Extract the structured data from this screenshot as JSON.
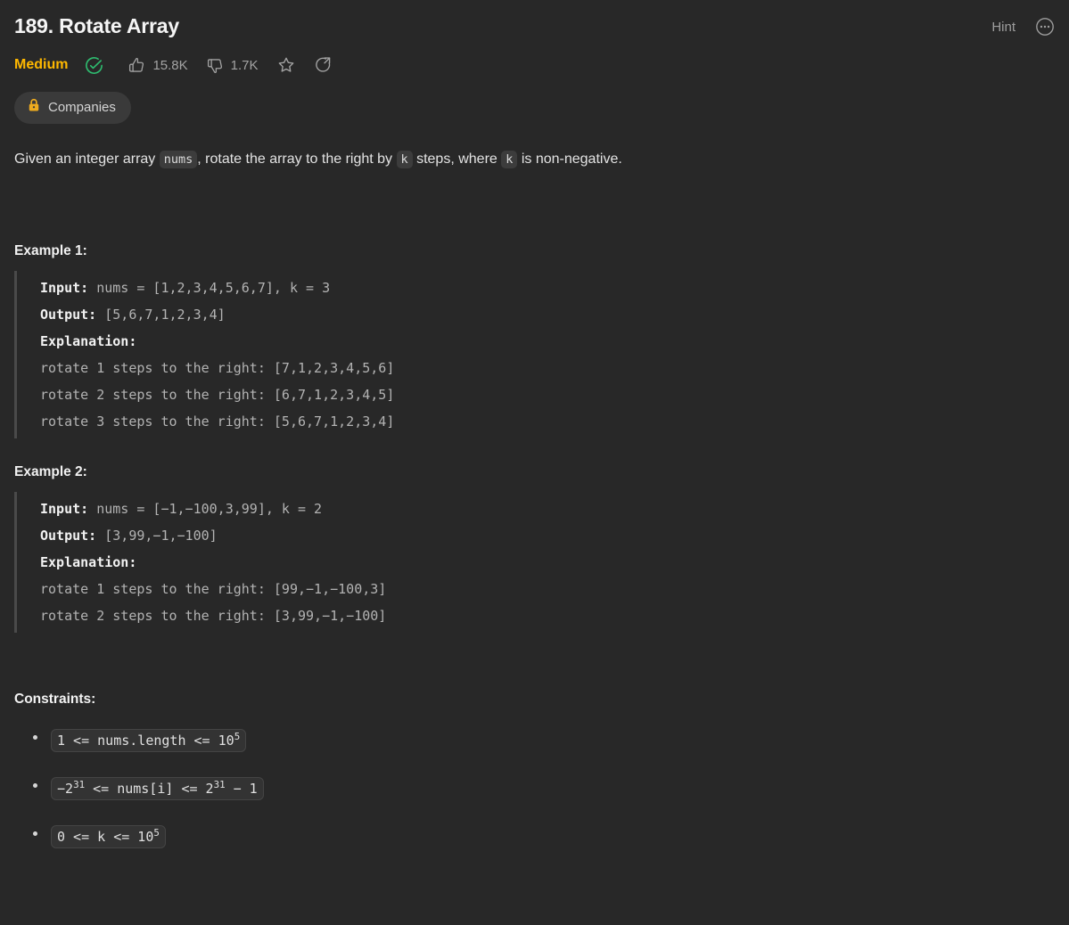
{
  "header": {
    "title": "189. Rotate Array",
    "hint_label": "Hint",
    "more_icon": "ellipsis-circle-icon"
  },
  "meta": {
    "difficulty": "Medium",
    "difficulty_color": "#ffb800",
    "solved_icon": "check-circle-icon",
    "solved_color": "#2ebd70",
    "likes": "15.8K",
    "dislikes": "1.7K",
    "like_icon": "thumbs-up-icon",
    "dislike_icon": "thumbs-down-icon",
    "favorite_icon": "star-icon",
    "share_icon": "share-icon"
  },
  "companies": {
    "label": "Companies",
    "lock_icon": "lock-icon",
    "lock_color": "#eeab1f"
  },
  "description": {
    "part1": "Given an integer array ",
    "code1": "nums",
    "part2": ", rotate the array to the right by ",
    "code2": "k",
    "part3": " steps, where ",
    "code3": "k",
    "part4": " is non-negative."
  },
  "examples": [
    {
      "heading": "Example 1:",
      "input_label": "Input:",
      "input_value": " nums = [1,2,3,4,5,6,7], k = 3",
      "output_label": "Output:",
      "output_value": " [5,6,7,1,2,3,4]",
      "explanation_label": "Explanation:",
      "explanation_lines": [
        "rotate 1 steps to the right: [7,1,2,3,4,5,6]",
        "rotate 2 steps to the right: [6,7,1,2,3,4,5]",
        "rotate 3 steps to the right: [5,6,7,1,2,3,4]"
      ]
    },
    {
      "heading": "Example 2:",
      "input_label": "Input:",
      "input_value": " nums = [−1,−100,3,99], k = 2",
      "output_label": "Output:",
      "output_value": " [3,99,−1,−100]",
      "explanation_label": "Explanation:",
      "explanation_lines": [
        "rotate 1 steps to the right: [99,−1,−100,3]",
        "rotate 2 steps to the right: [3,99,−1,−100]"
      ]
    }
  ],
  "constraints": {
    "heading": "Constraints:",
    "items": [
      {
        "pre": "1 <= nums.length <= 10",
        "sup": "5",
        "post": ""
      },
      {
        "pre": "−2",
        "sup": "31",
        "post": " <= nums[i] <= 2",
        "sup2": "31",
        "post2": " − 1"
      },
      {
        "pre": "0 <= k <= 10",
        "sup": "5",
        "post": ""
      }
    ]
  },
  "theme": {
    "background": "#282828",
    "text": "#e3e3e3",
    "code_chip_bg": "#3c3c3c"
  }
}
